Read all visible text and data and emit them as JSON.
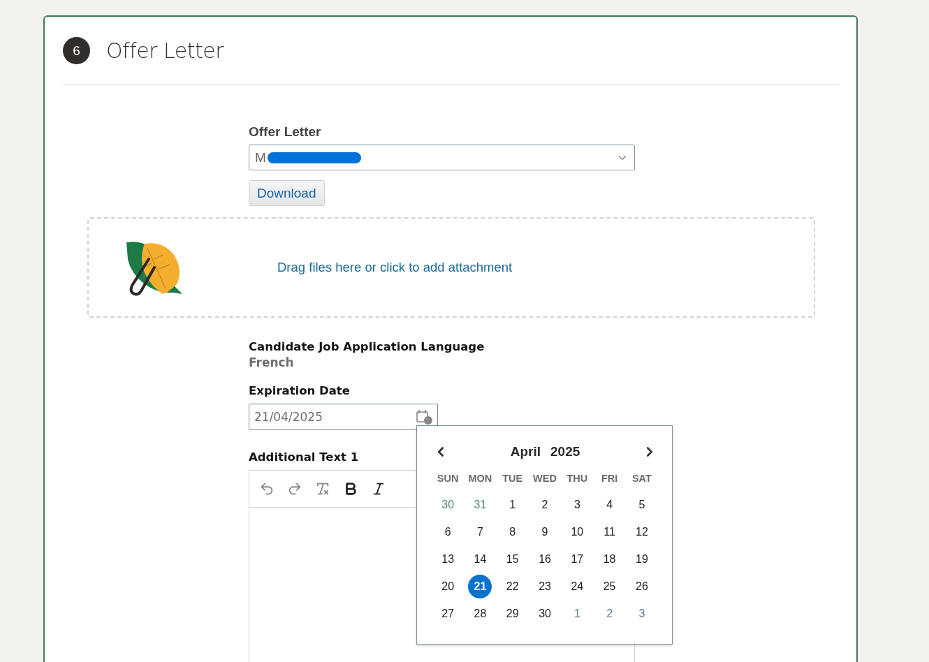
{
  "section": {
    "number": "6",
    "title": "Offer Letter"
  },
  "offer_letter": {
    "label": "Offer Letter",
    "value": "M",
    "redacted": true,
    "button": "Download"
  },
  "attachment": {
    "text": "Drag files here or click to add attachment"
  },
  "language": {
    "label": "Candidate Job Application Language",
    "value": "French"
  },
  "expiration": {
    "label": "Expiration Date",
    "value": "21/04/2025"
  },
  "additional_text": {
    "label": "Additional Text 1"
  },
  "calendar": {
    "month": "April",
    "year": "2025",
    "weekdays": [
      "SUN",
      "MON",
      "TUE",
      "WED",
      "THU",
      "FRI",
      "SAT"
    ],
    "days": [
      {
        "label": "30",
        "other_month": true,
        "selected": false
      },
      {
        "label": "31",
        "other_month": true,
        "selected": false
      },
      {
        "label": "1",
        "other_month": false,
        "selected": false
      },
      {
        "label": "2",
        "other_month": false,
        "selected": false
      },
      {
        "label": "3",
        "other_month": false,
        "selected": false
      },
      {
        "label": "4",
        "other_month": false,
        "selected": false
      },
      {
        "label": "5",
        "other_month": false,
        "selected": false
      },
      {
        "label": "6",
        "other_month": false,
        "selected": false
      },
      {
        "label": "7",
        "other_month": false,
        "selected": false
      },
      {
        "label": "8",
        "other_month": false,
        "selected": false
      },
      {
        "label": "9",
        "other_month": false,
        "selected": false
      },
      {
        "label": "10",
        "other_month": false,
        "selected": false
      },
      {
        "label": "11",
        "other_month": false,
        "selected": false
      },
      {
        "label": "12",
        "other_month": false,
        "selected": false
      },
      {
        "label": "13",
        "other_month": false,
        "selected": false
      },
      {
        "label": "14",
        "other_month": false,
        "selected": false
      },
      {
        "label": "15",
        "other_month": false,
        "selected": false
      },
      {
        "label": "16",
        "other_month": false,
        "selected": false
      },
      {
        "label": "17",
        "other_month": false,
        "selected": false
      },
      {
        "label": "18",
        "other_month": false,
        "selected": false
      },
      {
        "label": "19",
        "other_month": false,
        "selected": false
      },
      {
        "label": "20",
        "other_month": false,
        "selected": false
      },
      {
        "label": "21",
        "other_month": false,
        "selected": true
      },
      {
        "label": "22",
        "other_month": false,
        "selected": false
      },
      {
        "label": "23",
        "other_month": false,
        "selected": false
      },
      {
        "label": "24",
        "other_month": false,
        "selected": false
      },
      {
        "label": "25",
        "other_month": false,
        "selected": false
      },
      {
        "label": "26",
        "other_month": false,
        "selected": false
      },
      {
        "label": "27",
        "other_month": false,
        "selected": false
      },
      {
        "label": "28",
        "other_month": false,
        "selected": false
      },
      {
        "label": "29",
        "other_month": false,
        "selected": false
      },
      {
        "label": "30",
        "other_month": false,
        "selected": false
      },
      {
        "label": "1",
        "other_month": true,
        "selected": false
      },
      {
        "label": "2",
        "other_month": true,
        "selected": false
      },
      {
        "label": "3",
        "other_month": true,
        "selected": false
      }
    ]
  }
}
